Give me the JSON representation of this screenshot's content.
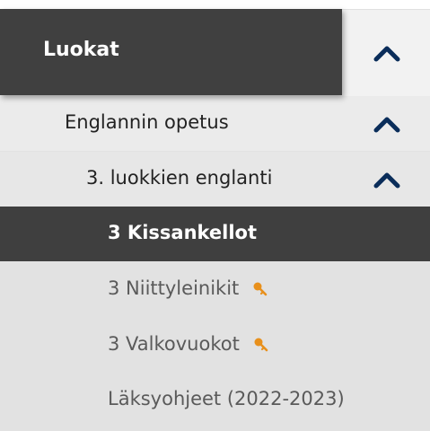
{
  "menu": {
    "header_label": "Luokat",
    "items": [
      {
        "label": "Englannin opetus",
        "expanded": true
      },
      {
        "label": "3. luokkien englanti",
        "expanded": true
      },
      {
        "label": "3 Kissankellot",
        "active": true
      },
      {
        "label": "3 Niittyleinikit",
        "icon": "key-icon"
      },
      {
        "label": "3 Valkovuokot",
        "icon": "key-icon"
      },
      {
        "label": "Läksyohjeet (2022-2023)"
      }
    ]
  },
  "colors": {
    "header_bg": "#404040",
    "active_bg": "#3f3f3f",
    "chevron": "#0a2d5a",
    "key_icon": "#e8901c"
  }
}
